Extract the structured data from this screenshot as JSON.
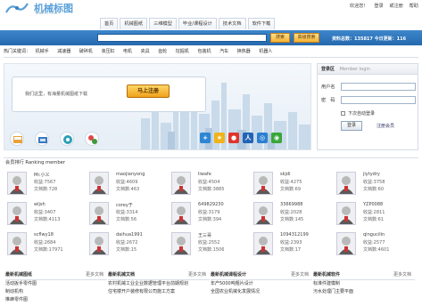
{
  "header": {
    "logo_text": "机械标图",
    "logo_sub": "JXBBTU.COM",
    "links": [
      "欢迎您！",
      "登录",
      "或注册",
      "帮助"
    ]
  },
  "nav": {
    "tabs": [
      "首页",
      "机械图纸",
      "三维模型",
      "毕业/课程设计",
      "技术文档",
      "软件下载"
    ]
  },
  "search": {
    "placeholder": "",
    "button_label": "搜索",
    "advanced_label": "高级搜索",
    "stats": "资料总数：135817 今日更新：116"
  },
  "hot": {
    "label": "热门关键词：",
    "keywords": [
      "机械手",
      "减速器",
      "破碎机",
      "液压缸",
      "电机",
      "夹具",
      "齿轮",
      "挖掘机",
      "包装机",
      "汽车",
      "换热器",
      "机器人"
    ]
  },
  "banner": {
    "text": "我们这里，有海量机械图纸下载",
    "register_label": "马上注册",
    "share_icons": [
      "plus-share-icon",
      "qq-space-icon",
      "weibo-icon",
      "renren-icon",
      "kaixin-icon",
      "wechat-icon"
    ]
  },
  "login": {
    "title": "登录区",
    "title_en": "Member login",
    "username_label": "用户名",
    "password_label": "密　码",
    "remember_label": "下次自动登录",
    "submit_label": "登录",
    "join_label": "注册会员"
  },
  "ranking": {
    "title": "会员排行 Ranking member",
    "members": [
      {
        "name": "Mr.小义",
        "score": "收益:7567",
        "docs": "文档数:728"
      },
      {
        "name": "maojianyong",
        "score": "收益:4609",
        "docs": "文档数:463"
      },
      {
        "name": "liwafe",
        "score": "收益:4504",
        "docs": "文档数:3885"
      },
      {
        "name": "skjdi",
        "score": "收益:4275",
        "docs": "文档数:69"
      },
      {
        "name": "jiytydry",
        "score": "收益:3758",
        "docs": "文档数:60"
      },
      {
        "name": "wljsh",
        "score": "收益:3407",
        "docs": "文档数:4113"
      },
      {
        "name": "corey于",
        "score": "收益:3314",
        "docs": "文档数:56"
      },
      {
        "name": "649829230",
        "score": "收益:3179",
        "docs": "文档数:394"
      },
      {
        "name": "33669988",
        "score": "收益:2028",
        "docs": "文档数:145"
      },
      {
        "name": "YZP0088",
        "score": "收益:2811",
        "docs": "文档数:61"
      },
      {
        "name": "scflwy18",
        "score": "收益:2684",
        "docs": "文档数:17971"
      },
      {
        "name": "daihua1991",
        "score": "收益:2672",
        "docs": "文档数:15"
      },
      {
        "name": "王三哥",
        "score": "收益:2552",
        "docs": "文档数:1506"
      },
      {
        "name": "1094312199",
        "score": "收益:2393",
        "docs": "文档数:17"
      },
      {
        "name": "qingucilin",
        "score": "收益:2577",
        "docs": "文档数:4601"
      }
    ]
  },
  "columns": [
    {
      "title": "最新机械图纸",
      "more": "更多文档",
      "items": [
        "活动扳手零件图",
        "制动机构",
        "推蜂零件图"
      ]
    },
    {
      "title": "最新机械文档",
      "more": "更多文档",
      "items": [
        "农村机械工业企业数据管理平台前期规划",
        "住宅楼开户装修有限公司施工方案"
      ]
    },
    {
      "title": "最新机械课程设计",
      "more": "更多文档",
      "items": [
        "年产5000吨粗片设计",
        "全国农业机械化发展情况"
      ]
    },
    {
      "title": "最新机械软件",
      "more": "更多文档",
      "items": [
        "标准件建模制",
        "污水处理门主要平面"
      ]
    }
  ]
}
